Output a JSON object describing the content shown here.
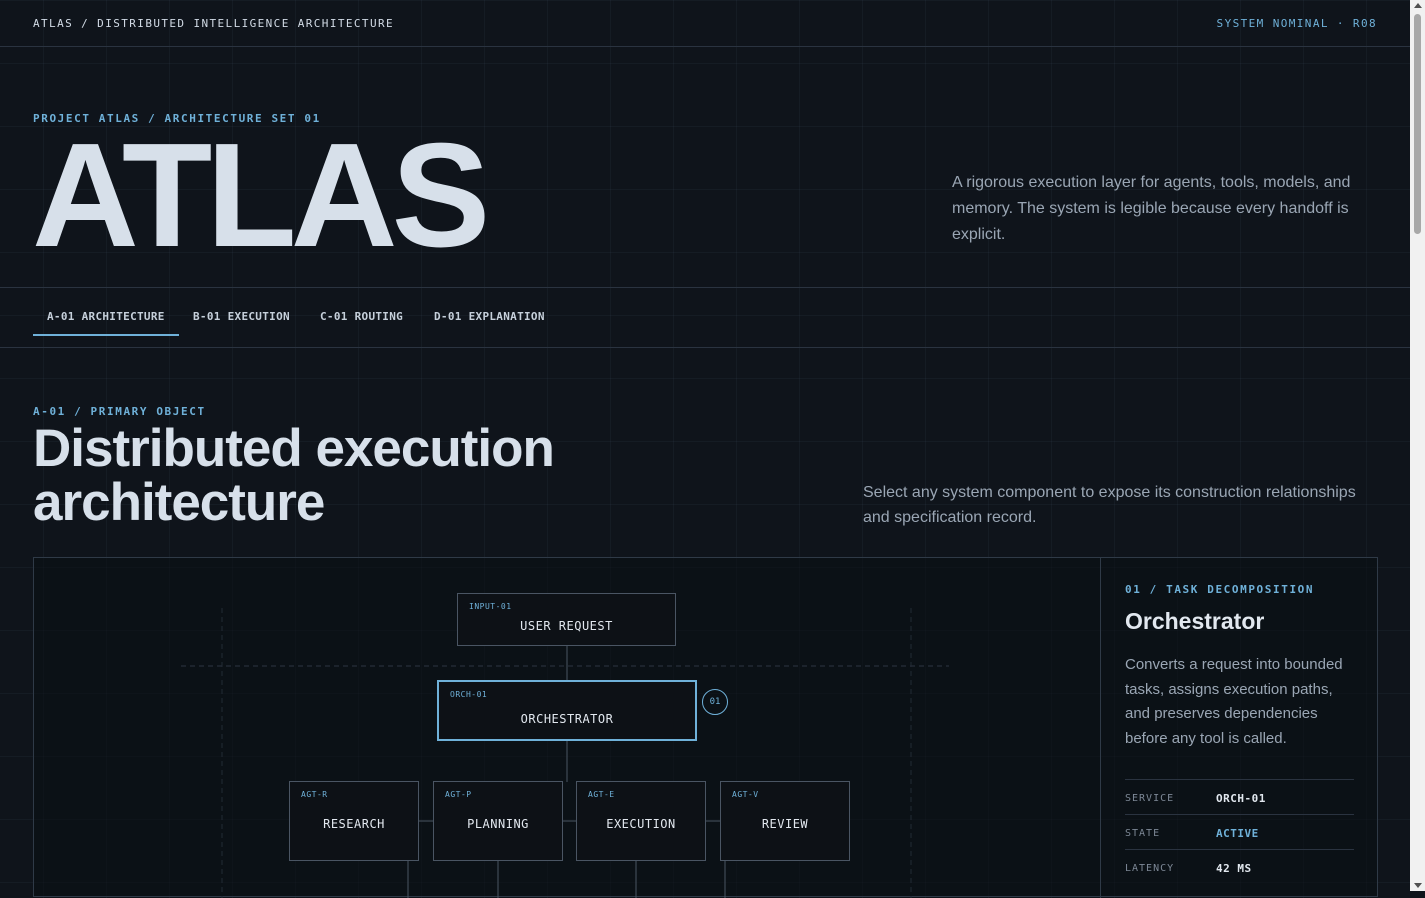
{
  "topbar": {
    "title": "ATLAS / DISTRIBUTED INTELLIGENCE ARCHITECTURE",
    "status": "SYSTEM NOMINAL · R08"
  },
  "hero": {
    "eyebrow": "PROJECT ATLAS / ARCHITECTURE SET 01",
    "title": "ATLAS",
    "description": "A rigorous execution layer for agents, tools, models, and memory. The system is legible because every handoff is explicit."
  },
  "tabs": [
    {
      "label": "A-01 ARCHITECTURE",
      "active": true
    },
    {
      "label": "B-01 EXECUTION",
      "active": false
    },
    {
      "label": "C-01 ROUTING",
      "active": false
    },
    {
      "label": "D-01 EXPLANATION",
      "active": false
    }
  ],
  "section": {
    "eyebrow": "A-01 / PRIMARY OBJECT",
    "title_line1": "Distributed execution",
    "title_line2": "architecture",
    "description": "Select any system component to expose its construction relationships and specification record."
  },
  "diagram": {
    "input": {
      "code": "INPUT-01",
      "label": "USER REQUEST"
    },
    "orchestrator": {
      "code": "ORCH-01",
      "label": "ORCHESTRATOR",
      "badge": "01"
    },
    "agents": [
      {
        "code": "AGT-R",
        "label": "RESEARCH"
      },
      {
        "code": "AGT-P",
        "label": "PLANNING"
      },
      {
        "code": "AGT-E",
        "label": "EXECUTION"
      },
      {
        "code": "AGT-V",
        "label": "REVIEW"
      }
    ]
  },
  "detail": {
    "eyebrow": "01 / TASK DECOMPOSITION",
    "name": "Orchestrator",
    "description": "Converts a request into bounded tasks, assigns execution paths, and preserves dependencies before any tool is called.",
    "specs": [
      {
        "key": "SERVICE",
        "value": "ORCH-01"
      },
      {
        "key": "STATE",
        "value": "ACTIVE"
      },
      {
        "key": "LATENCY",
        "value": "42 MS"
      }
    ]
  },
  "colors": {
    "accent": "#6fb1d9",
    "background": "#0f141b",
    "text": "#d7e0ea"
  }
}
